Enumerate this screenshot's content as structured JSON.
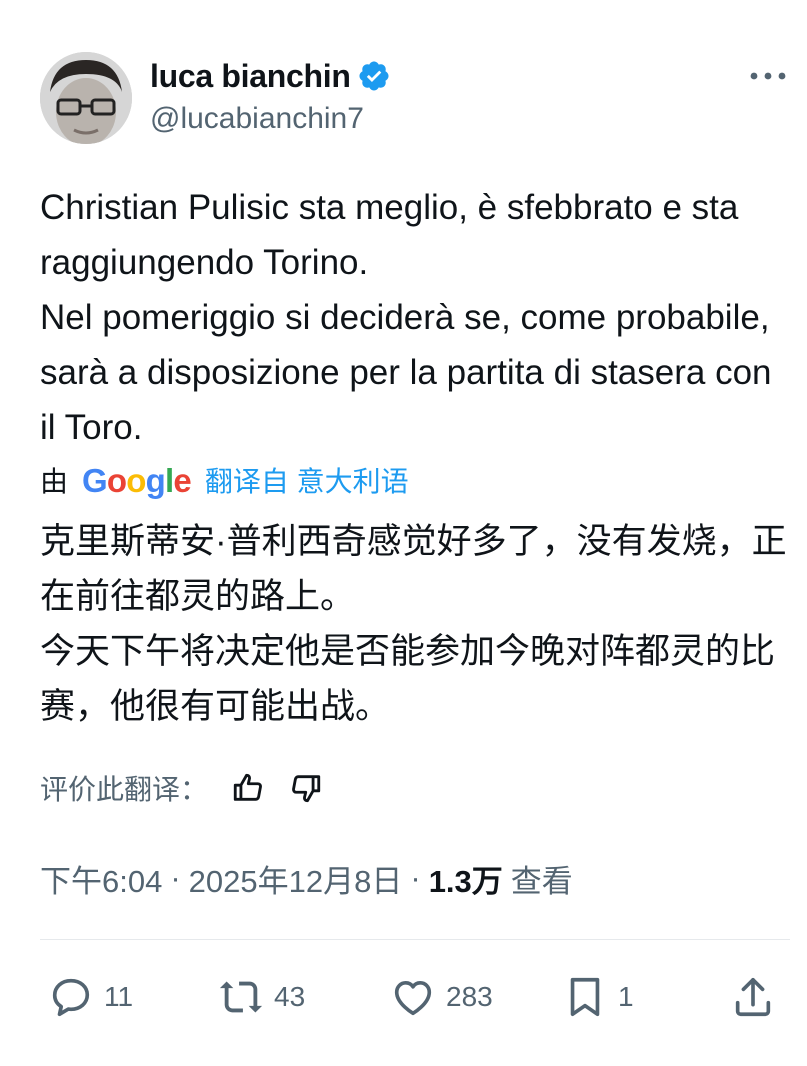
{
  "author": {
    "name": "luca bianchin",
    "handle": "@lucabianchin7",
    "verified": true
  },
  "tweet": {
    "text_lines": [
      "Christian Pulisic sta meglio, è sfebbrato e sta raggiungendo Torino.",
      "Nel pomeriggio si deciderà se, come probabile, sarà a disposizione per la partita di stasera con il Toro."
    ]
  },
  "translation": {
    "by_label": "由",
    "provider": "Google",
    "link_text": "翻译自 意大利语",
    "text_lines": [
      "克里斯蒂安·普利西奇感觉好多了，没有发烧，正在前往都灵的路上。",
      "今天下午将决定他是否能参加今晚对阵都灵的比赛，他很有可能出战。"
    ],
    "rate_label": "评价此翻译：",
    "icons": {
      "up": "thumbs-up-icon",
      "down": "thumbs-down-icon"
    }
  },
  "meta": {
    "time": "下午6:04",
    "sep1": "·",
    "date": "2025年12月8日",
    "sep2": "·",
    "views": "1.3万",
    "views_label": "查看"
  },
  "actions": {
    "replies": "11",
    "reposts": "43",
    "likes": "283",
    "bookmarks": "1"
  },
  "colors": {
    "text": "#0f1419",
    "secondary": "#536471",
    "link": "#1d9bf0",
    "verified": "#1d9bf0"
  }
}
